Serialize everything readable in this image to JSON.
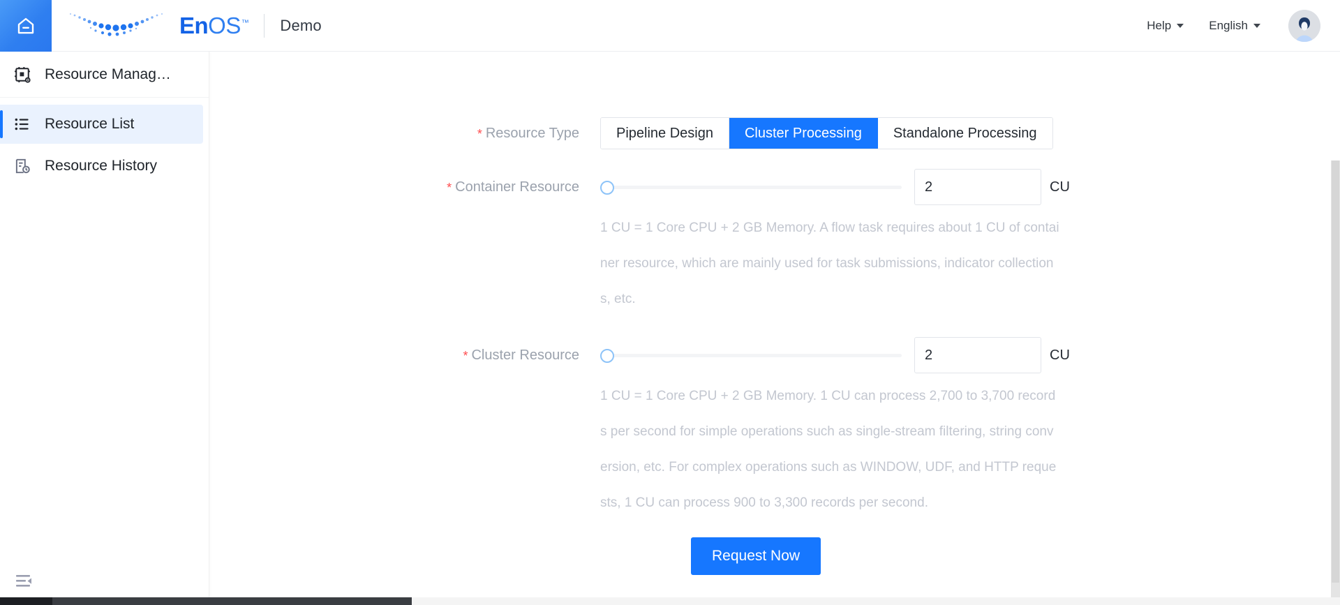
{
  "topbar": {
    "home_icon": "home-icon",
    "brand": {
      "en": "En",
      "os": "OS",
      "tm": "™"
    },
    "tenant": "Demo",
    "help_label": "Help",
    "language_label": "English",
    "avatar_icon": "user-avatar-icon"
  },
  "sidebar": {
    "header": {
      "icon": "resource-chip-icon",
      "label": "Resource Manag…"
    },
    "items": [
      {
        "icon": "list-icon",
        "label": "Resource List",
        "active": true
      },
      {
        "icon": "history-file-icon",
        "label": "Resource History",
        "active": false
      }
    ],
    "collapse_icon": "menu-fold-icon"
  },
  "form": {
    "resource_type": {
      "label": "Resource Type",
      "required_mark": "*",
      "options": [
        {
          "label": "Pipeline Design",
          "selected": false
        },
        {
          "label": "Cluster Processing",
          "selected": true
        },
        {
          "label": "Standalone Processing",
          "selected": false
        }
      ]
    },
    "container_resource": {
      "label": "Container Resource",
      "required_mark": "*",
      "value": "2",
      "unit": "CU",
      "slider_percent": 0,
      "help": "1 CU = 1 Core CPU + 2 GB Memory. A flow task requires about 1 CU of container resource, which are mainly used for task submissions, indicator collections, etc."
    },
    "cluster_resource": {
      "label": "Cluster Resource",
      "required_mark": "*",
      "value": "2",
      "unit": "CU",
      "slider_percent": 0,
      "help": "1 CU = 1 Core CPU + 2 GB Memory. 1 CU can process 2,700 to 3,700 records per second for simple operations such as single-stream filtering, string conversion, etc. For complex operations such as WINDOW, UDF, and HTTP requests, 1 CU can process 900 to 3,300 records per second."
    },
    "submit_label": "Request Now"
  },
  "colors": {
    "accent": "#1677ff",
    "required": "#ff4d4f",
    "active_bg": "#eaf2fe",
    "muted_text": "#c3c7d0",
    "label_text": "#9ba2ad"
  }
}
